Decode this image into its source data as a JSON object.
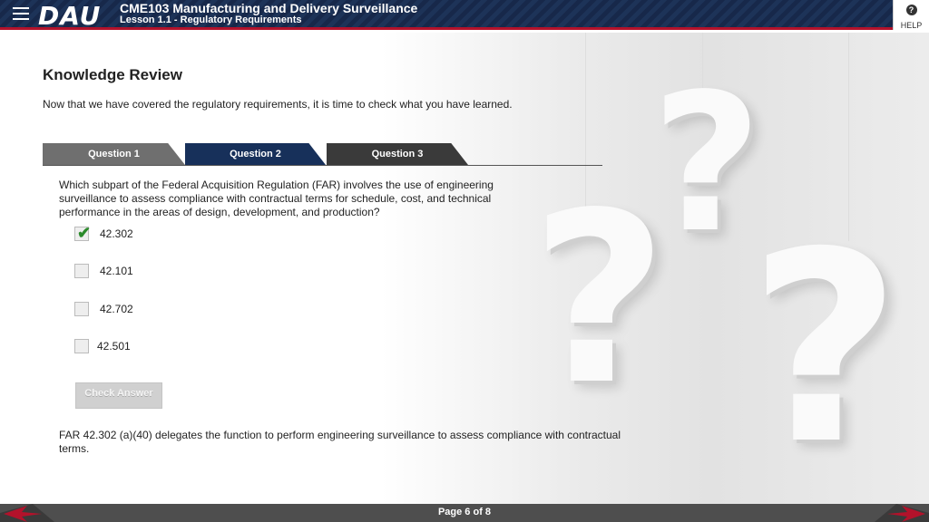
{
  "header": {
    "logo": "DAU",
    "course_title": "CME103 Manufacturing and Delivery Surveillance",
    "lesson_title": "Lesson 1.1 - Regulatory Requirements",
    "help_label": "HELP",
    "help_icon": "?"
  },
  "main": {
    "title": "Knowledge Review",
    "intro": "Now that we have covered the regulatory requirements, it is time to check what you have learned.",
    "tabs": [
      {
        "label": "Question 1"
      },
      {
        "label": "Question 2"
      },
      {
        "label": "Question 3"
      }
    ],
    "active_tab": "Question 2",
    "question": "Which subpart of the Federal Acquisition Regulation (FAR) involves the use of engineering surveillance to assess compliance with contractual terms for schedule, cost, and technical performance in the areas of design, development, and production?",
    "options": [
      {
        "label": "42.302",
        "checked": true
      },
      {
        "label": "42.101",
        "checked": false
      },
      {
        "label": "42.702",
        "checked": false
      },
      {
        "label": "42.501",
        "checked": false
      }
    ],
    "check_button": "Check Answer",
    "feedback": "FAR 42.302 (a)(40) delegates the function to perform engineering surveillance to assess compliance with contractual terms."
  },
  "footer": {
    "page_indicator": "Page 6 of 8"
  },
  "colors": {
    "header_bg": "#1d3358",
    "accent_red": "#b3122b",
    "tab_active": "#17305a",
    "tab_inactive": "#6f6f6f",
    "check_green": "#2a8a2a"
  },
  "icons": {
    "menu": "hamburger-icon",
    "help": "help-icon",
    "check": "checkmark-icon",
    "prev": "arrow-left-icon",
    "next": "arrow-right-icon"
  }
}
